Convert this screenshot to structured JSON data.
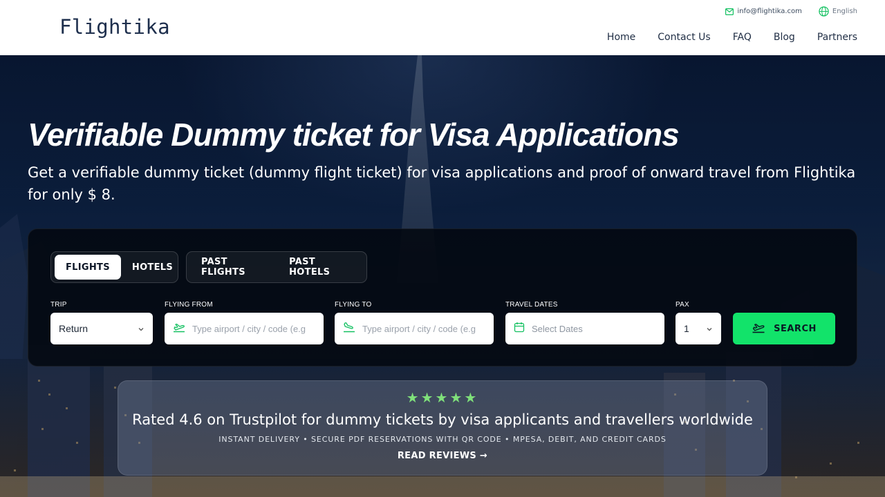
{
  "header": {
    "logo": "Flightika",
    "email": "info@flightika.com",
    "language": "English",
    "nav": [
      "Home",
      "Contact Us",
      "FAQ",
      "Blog",
      "Partners"
    ]
  },
  "hero": {
    "title": "Verifiable Dummy ticket for Visa Applications",
    "subtitle": "Get a verifiable dummy ticket (dummy flight ticket) for visa applications and proof of onward travel from Flightika for only $ 8."
  },
  "search": {
    "tabs_group1": [
      {
        "label": "FLIGHTS",
        "active": true
      },
      {
        "label": "HOTELS",
        "active": false
      }
    ],
    "tabs_group2": [
      {
        "label": "PAST FLIGHTS",
        "active": false
      },
      {
        "label": "PAST HOTELS",
        "active": false
      }
    ],
    "trip": {
      "label": "TRIP",
      "value": "Return"
    },
    "from": {
      "label": "FLYING FROM",
      "placeholder": "Type airport / city / code (e.g",
      "icon": "plane-takeoff-icon"
    },
    "to": {
      "label": "FLYING TO",
      "placeholder": "Type airport / city / code (e.g",
      "icon": "plane-landing-icon"
    },
    "dates": {
      "label": "TRAVEL DATES",
      "placeholder": "Select Dates",
      "icon": "calendar-icon"
    },
    "pax": {
      "label": "PAX",
      "value": "1"
    },
    "search_button": "SEARCH"
  },
  "rating": {
    "stars": "★★★★★",
    "title": "Rated 4.6 on Trustpilot for dummy tickets by visa applicants and travellers worldwide",
    "features": "INSTANT DELIVERY • SECURE PDF RESERVATIONS WITH QR CODE • MPESA, DEBIT, AND CREDIT CARDS",
    "cta": "READ REVIEWS →"
  },
  "colors": {
    "accent": "#12e36a",
    "header_bg": "#ffffff",
    "panel_bg": "#03080f",
    "star": "#7fe07a"
  }
}
